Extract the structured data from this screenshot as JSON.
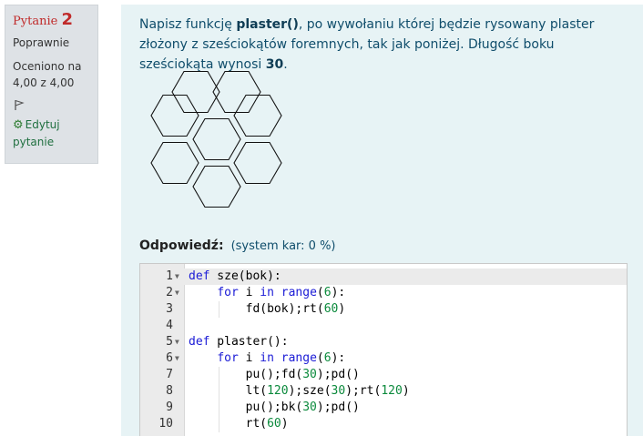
{
  "info": {
    "question_word": "Pytanie",
    "question_number": "2",
    "state": "Poprawnie",
    "grade_line1": "Oceniono na",
    "grade_line2": "4,00 z 4,00",
    "edit_line1": "Edytuj",
    "edit_line2": "pytanie",
    "flag_icon": "flag-icon",
    "edit_icon": "gear-icon"
  },
  "question": {
    "text_1": "Napisz funkcję ",
    "func": "plaster()",
    "text_2": ", po wywołaniu której będzie rysowany plaster złożony z sześciokątów foremnych, tak jak poniżej. Długość boku sześciokąta wynosi ",
    "side": "30",
    "text_3": "."
  },
  "answer": {
    "label": "Odpowiedź:",
    "penalty": "(system kar: 0 %)"
  },
  "code": {
    "line_numbers": [
      "1",
      "2",
      "3",
      "4",
      "5",
      "6",
      "7",
      "8",
      "9",
      "10"
    ]
  },
  "colors": {
    "accent_red": "#c02a2a",
    "panel_bg": "#e7f3f5",
    "info_bg": "#dee2e6"
  }
}
